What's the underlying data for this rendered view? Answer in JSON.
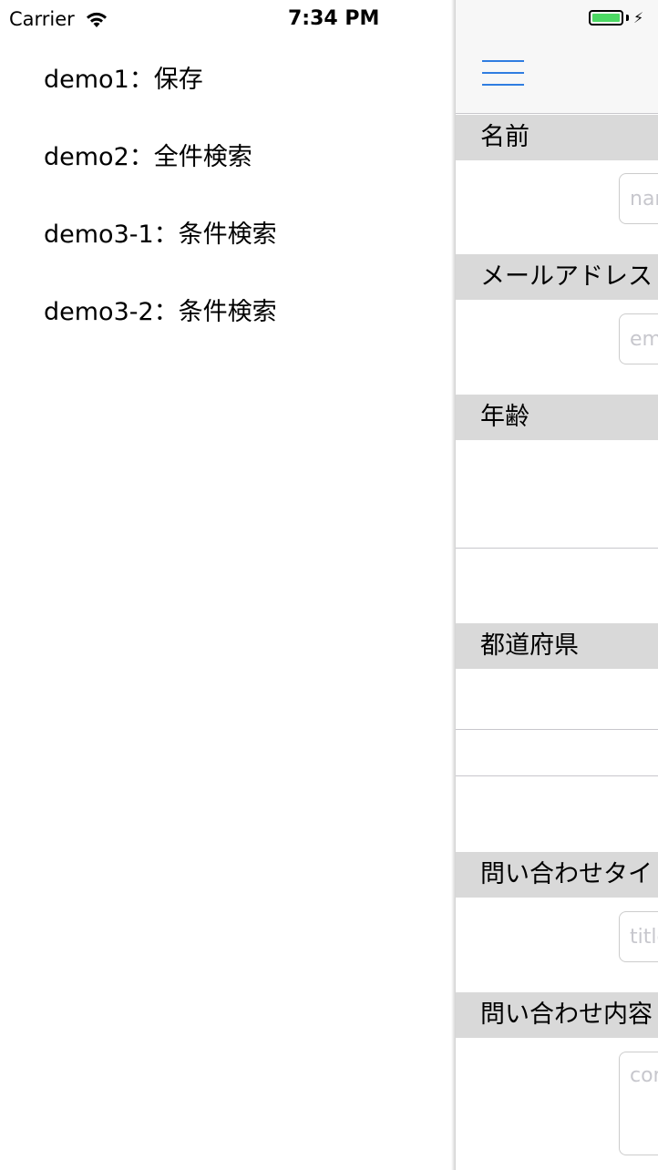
{
  "status_bar": {
    "carrier": "Carrier",
    "time": "7:34 PM",
    "wifi_icon": "wifi-icon",
    "battery_icon": "battery-icon",
    "charging_icon": "bolt-icon",
    "battery_color": "#4cd964"
  },
  "menu": {
    "items": [
      {
        "label": "demo1：保存"
      },
      {
        "label": "demo2：全件検索"
      },
      {
        "label": "demo3-1：条件検索"
      },
      {
        "label": "demo3-2：条件検索"
      }
    ]
  },
  "navbar": {
    "menu_icon": "hamburger-icon",
    "accent_color": "#2f7de1"
  },
  "form": {
    "name": {
      "label": "名前",
      "placeholder": "name"
    },
    "email": {
      "label": "メールアドレス",
      "placeholder": "email"
    },
    "age": {
      "label": "年齢"
    },
    "prefecture": {
      "label": "都道府県"
    },
    "title": {
      "label": "問い合わせタイトル",
      "placeholder": "title"
    },
    "content": {
      "label": "問い合わせ内容",
      "placeholder": "content"
    }
  }
}
